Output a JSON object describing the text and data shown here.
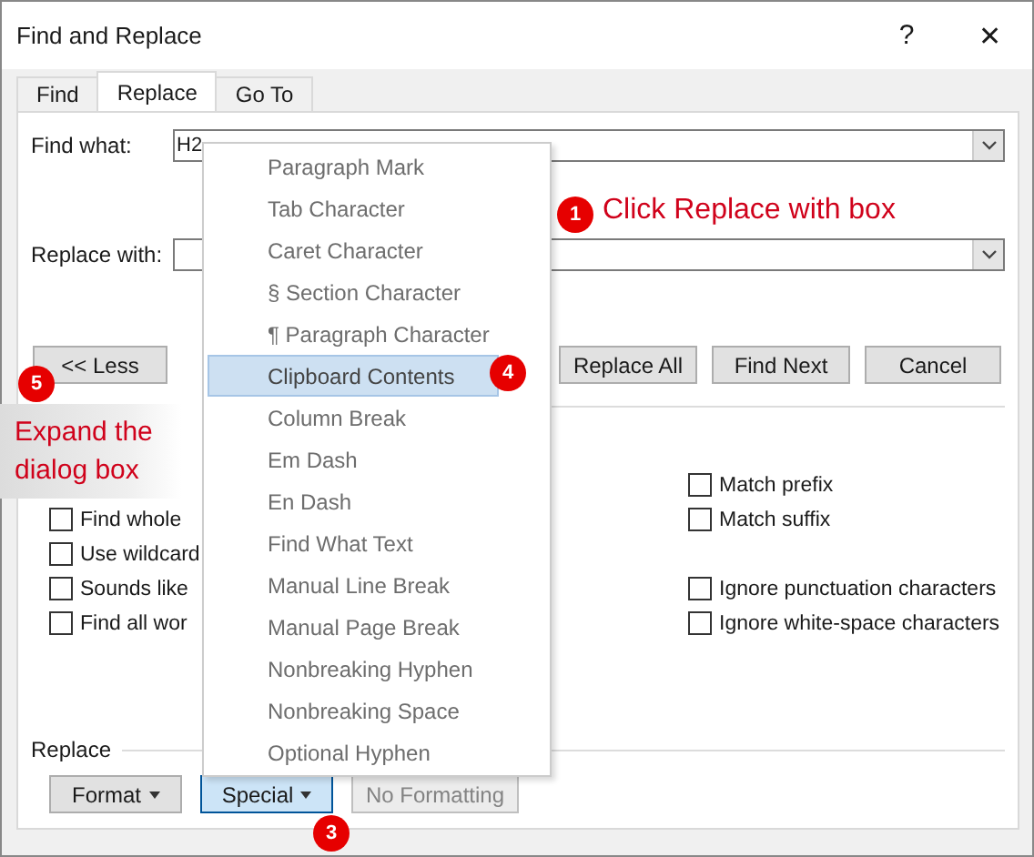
{
  "window": {
    "title": "Find and Replace",
    "help": "?",
    "close": "✕"
  },
  "tabs": [
    {
      "label": "Find",
      "selected": false
    },
    {
      "label": "Replace",
      "selected": true
    },
    {
      "label": "Go To",
      "selected": false
    }
  ],
  "find_what": {
    "label": "Find what:",
    "value": "H2"
  },
  "replace_with": {
    "label": "Replace with:"
  },
  "buttons": {
    "less": "<< Less",
    "replace_all": "Replace All",
    "find_next": "Find Next",
    "cancel": "Cancel"
  },
  "options_left": [
    {
      "label": "Find whole",
      "checked": false
    },
    {
      "label": "Use wildcard",
      "checked": false
    },
    {
      "label": "Sounds like",
      "checked": false
    },
    {
      "label": "Find all wor",
      "checked": false
    }
  ],
  "options_right": [
    {
      "label": "Match prefix",
      "checked": false
    },
    {
      "label": "Match suffix",
      "checked": false
    },
    {
      "label": "Ignore punctuation characters",
      "checked": false
    },
    {
      "label": "Ignore white-space characters",
      "checked": false
    }
  ],
  "replace_section": {
    "label": "Replace",
    "buttons": [
      {
        "label": "Format",
        "dropdown": true,
        "selected": false,
        "disabled": false
      },
      {
        "label": "Special",
        "dropdown": true,
        "selected": true,
        "disabled": false
      },
      {
        "label": "No Formatting",
        "dropdown": false,
        "selected": false,
        "disabled": true
      }
    ]
  },
  "special_menu": [
    {
      "label": "Paragraph Mark",
      "selected": false
    },
    {
      "label": "Tab Character",
      "selected": false
    },
    {
      "label": "Caret Character",
      "selected": false
    },
    {
      "label": "§ Section Character",
      "selected": false
    },
    {
      "label": "¶ Paragraph Character",
      "selected": false
    },
    {
      "label": "Clipboard Contents",
      "selected": true
    },
    {
      "label": "Column Break",
      "selected": false
    },
    {
      "label": "Em Dash",
      "selected": false
    },
    {
      "label": "En Dash",
      "selected": false
    },
    {
      "label": "Find What Text",
      "selected": false
    },
    {
      "label": "Manual Line Break",
      "selected": false
    },
    {
      "label": "Manual Page Break",
      "selected": false
    },
    {
      "label": "Nonbreaking Hyphen",
      "selected": false
    },
    {
      "label": "Nonbreaking Space",
      "selected": false
    },
    {
      "label": "Optional Hyphen",
      "selected": false
    }
  ],
  "callouts": [
    {
      "number": "1",
      "text": "Click Replace with box"
    },
    {
      "number": "4"
    },
    {
      "number": "3"
    },
    {
      "number": "5",
      "text": "Expand the dialog box"
    }
  ]
}
